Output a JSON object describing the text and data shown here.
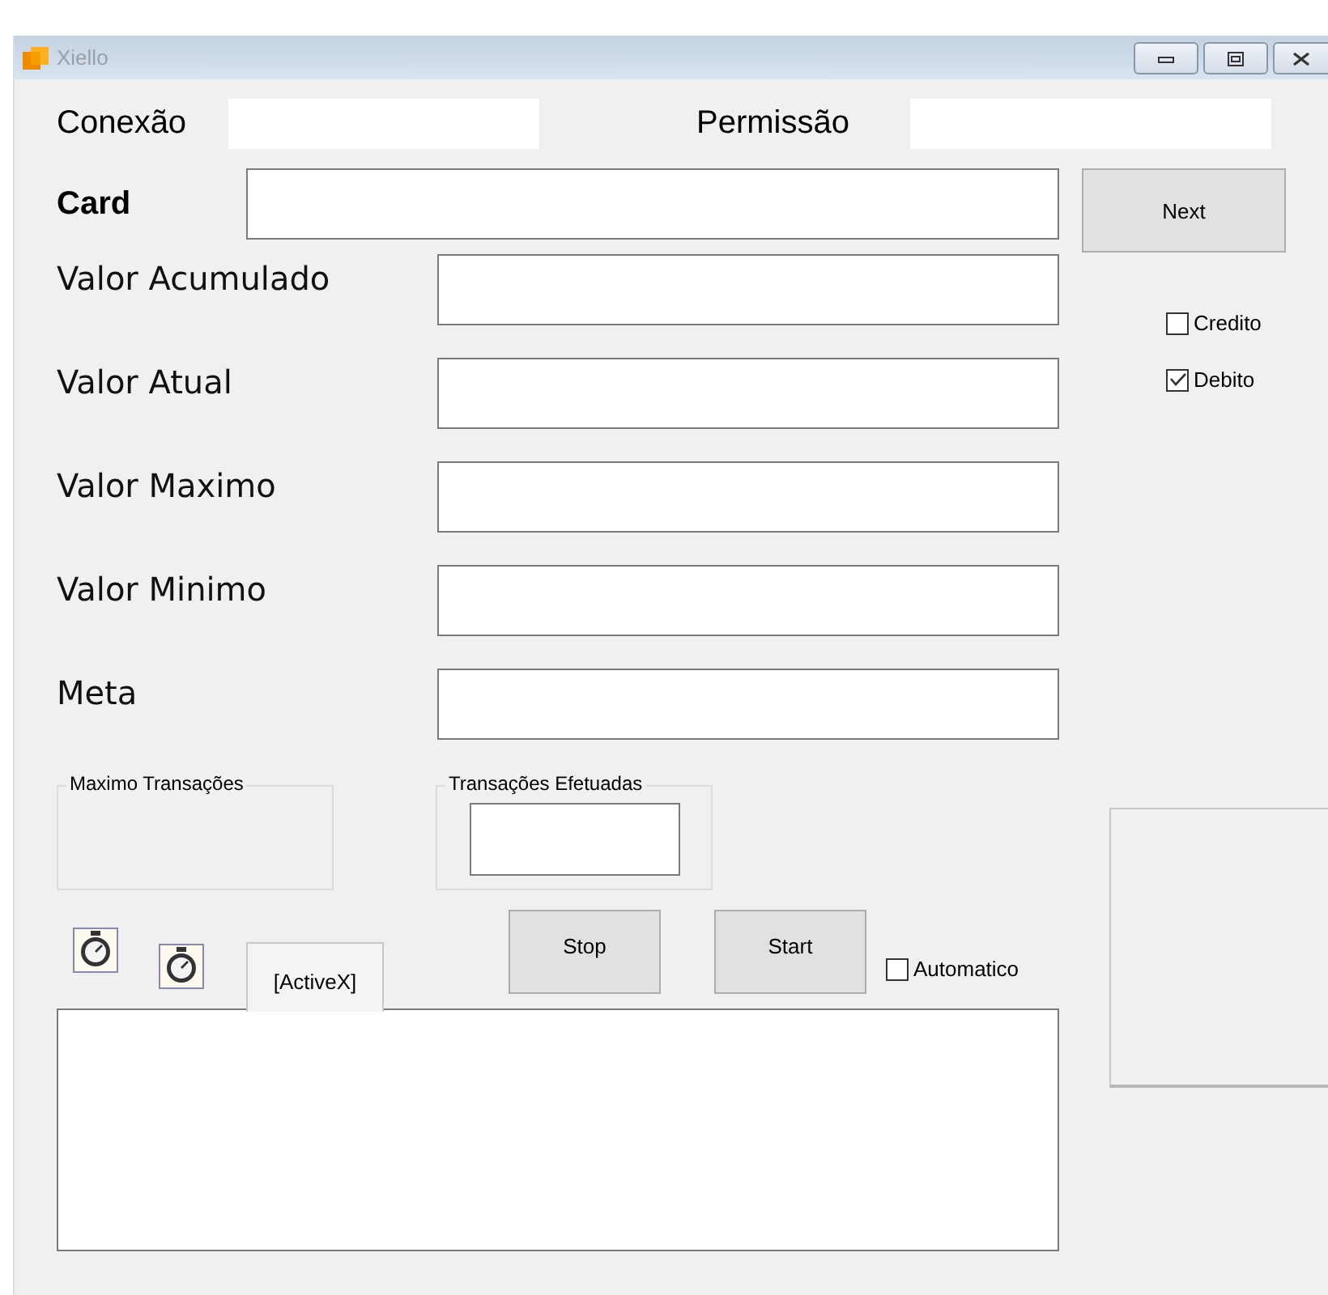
{
  "window": {
    "title": "Xiello"
  },
  "conexao": {
    "label": "Conexão"
  },
  "permissao": {
    "label": "Permissão"
  },
  "card": {
    "label": "Card"
  },
  "next_button": "Next",
  "value_fields": [
    "Valor Acumulado",
    "Valor Atual",
    "Valor Maximo",
    "Valor Minimo",
    "Meta"
  ],
  "options": [
    {
      "label": "Credito",
      "checked": false
    },
    {
      "label": "Debito",
      "checked": true
    }
  ],
  "groups": [
    {
      "title": "Maximo Transações",
      "kind": "empty"
    },
    {
      "title": "Transações Efetuadas",
      "kind": "field"
    }
  ],
  "activex_tab": "[ActiveX]",
  "buttons": [
    "Stop",
    "Start"
  ],
  "automatic": {
    "label": "Automatico",
    "checked": false
  }
}
